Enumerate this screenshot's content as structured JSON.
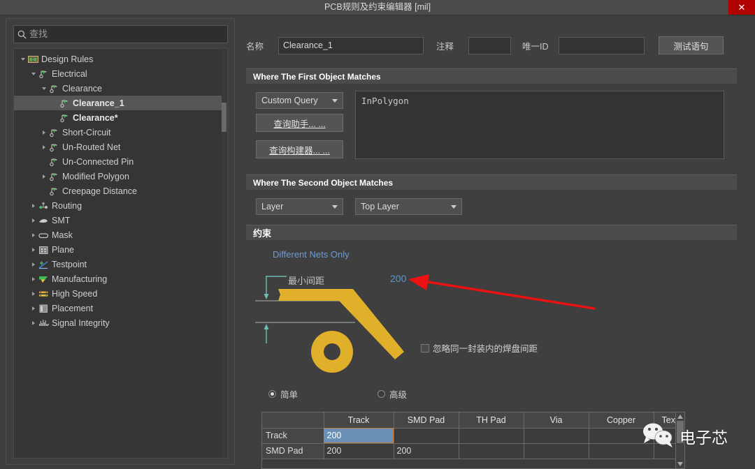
{
  "window": {
    "title": "PCB规则及约束编辑器 [mil]",
    "close_label": "✕",
    "close_color": "#b00000"
  },
  "sidebar": {
    "search": {
      "placeholder": "查找",
      "icon": "search-icon"
    },
    "tree": [
      {
        "label": "Design Rules",
        "depth": 0,
        "twisty": "open",
        "icon": "design-rules-icon",
        "selected": false,
        "bold": false
      },
      {
        "label": "Electrical",
        "depth": 1,
        "twisty": "open",
        "icon": "electrical-icon",
        "selected": false,
        "bold": false
      },
      {
        "label": "Clearance",
        "depth": 2,
        "twisty": "open",
        "icon": "clearance-icon",
        "selected": false,
        "bold": false
      },
      {
        "label": "Clearance_1",
        "depth": 3,
        "twisty": "none",
        "icon": "rule-icon",
        "selected": true,
        "bold": true
      },
      {
        "label": "Clearance*",
        "depth": 3,
        "twisty": "none",
        "icon": "rule-icon",
        "selected": false,
        "bold": true
      },
      {
        "label": "Short-Circuit",
        "depth": 2,
        "twisty": "closed",
        "icon": "short-circuit-icon",
        "selected": false,
        "bold": false
      },
      {
        "label": "Un-Routed Net",
        "depth": 2,
        "twisty": "closed",
        "icon": "unrouted-net-icon",
        "selected": false,
        "bold": false
      },
      {
        "label": "Un-Connected Pin",
        "depth": 2,
        "twisty": "none",
        "icon": "unconnected-pin-icon",
        "selected": false,
        "bold": false
      },
      {
        "label": "Modified Polygon",
        "depth": 2,
        "twisty": "closed",
        "icon": "modified-polygon-icon",
        "selected": false,
        "bold": false
      },
      {
        "label": "Creepage Distance",
        "depth": 2,
        "twisty": "none",
        "icon": "creepage-icon",
        "selected": false,
        "bold": false
      },
      {
        "label": "Routing",
        "depth": 1,
        "twisty": "closed",
        "icon": "routing-icon",
        "selected": false,
        "bold": false
      },
      {
        "label": "SMT",
        "depth": 1,
        "twisty": "closed",
        "icon": "smt-icon",
        "selected": false,
        "bold": false
      },
      {
        "label": "Mask",
        "depth": 1,
        "twisty": "closed",
        "icon": "mask-icon",
        "selected": false,
        "bold": false
      },
      {
        "label": "Plane",
        "depth": 1,
        "twisty": "closed",
        "icon": "plane-icon",
        "selected": false,
        "bold": false
      },
      {
        "label": "Testpoint",
        "depth": 1,
        "twisty": "closed",
        "icon": "testpoint-icon",
        "selected": false,
        "bold": false
      },
      {
        "label": "Manufacturing",
        "depth": 1,
        "twisty": "closed",
        "icon": "manufacturing-icon",
        "selected": false,
        "bold": false
      },
      {
        "label": "High Speed",
        "depth": 1,
        "twisty": "closed",
        "icon": "high-speed-icon",
        "selected": false,
        "bold": false
      },
      {
        "label": "Placement",
        "depth": 1,
        "twisty": "closed",
        "icon": "placement-icon",
        "selected": false,
        "bold": false
      },
      {
        "label": "Signal Integrity",
        "depth": 1,
        "twisty": "closed",
        "icon": "signal-integrity-icon",
        "selected": false,
        "bold": false
      }
    ]
  },
  "form": {
    "name_label": "名称",
    "name_value": "Clearance_1",
    "comment_label": "注释",
    "comment_value": "",
    "unique_id_label": "唯一ID",
    "unique_id_value": "",
    "test_query_button": "测试语句"
  },
  "first_object": {
    "header": "Where The First Object Matches",
    "scope_select": "Custom Query",
    "query_helper_button": "查询助手... ...",
    "query_builder_button": "查询构建器... ...",
    "query_text": "InPolygon"
  },
  "second_object": {
    "header": "Where The Second Object Matches",
    "scope_select": "Layer",
    "layer_select": "Top Layer"
  },
  "constraints": {
    "header": "约束",
    "different_nets_only": "Different Nets Only",
    "min_clearance_label": "最小间距",
    "min_clearance_value": "200",
    "ignore_pad_label": "忽略同一封装内的焊盘间距",
    "ignore_pad_checked": false,
    "mode_simple": "简单",
    "mode_advanced": "高级",
    "mode_selected": "简单",
    "accent_track_color": "#e0b02a",
    "dimension_line_color": "#6fbdb5",
    "value_color": "#5d93cf"
  },
  "matrix": {
    "columns": [
      "",
      "Track",
      "SMD Pad",
      "TH Pad",
      "Via",
      "Copper",
      "Text"
    ],
    "rows": [
      {
        "header": "Track",
        "cells": [
          "200",
          "",
          "",
          "",
          "",
          ""
        ],
        "selected_index": 0
      },
      {
        "header": "SMD Pad",
        "cells": [
          "200",
          "200",
          "",
          "",
          "",
          ""
        ],
        "selected_index": -1
      }
    ],
    "selected_cell_value": "200"
  },
  "annotation": {
    "arrow_color": "#ee1111",
    "points_to": "200"
  },
  "watermark": {
    "text": "电子芯",
    "icon": "wechat-icon"
  }
}
